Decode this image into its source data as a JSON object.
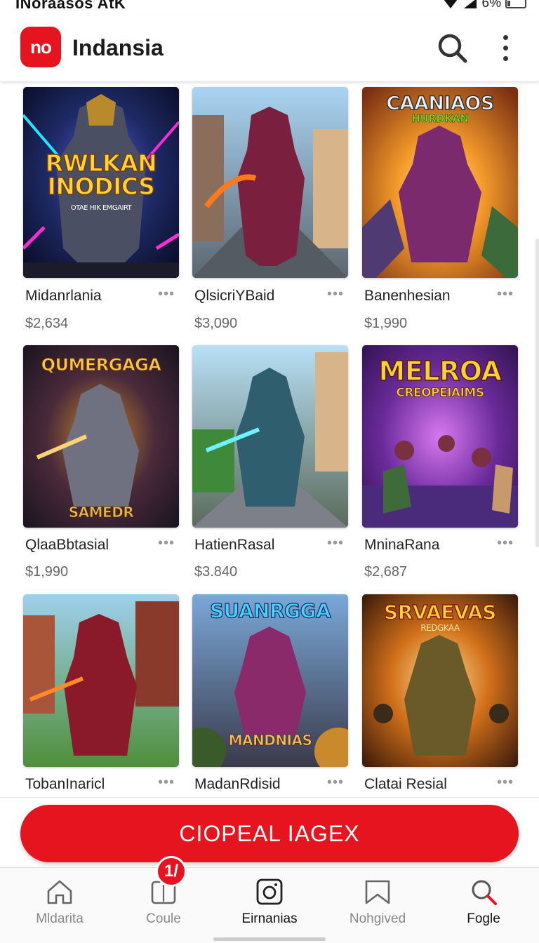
{
  "status_bar": {
    "carrier": "INoraasos AtK",
    "battery": "6%"
  },
  "app_bar": {
    "logo_text": "no",
    "title": "Indansia"
  },
  "grid": {
    "more_glyph": "•••",
    "items": [
      {
        "name": "Midanrlania",
        "price": "$2,634",
        "art_title": "RWLKAN INODICS",
        "art_subtitle": "OTAE HIK EMGAIRT"
      },
      {
        "name": "QlsicriYBaid",
        "price": "$3,090"
      },
      {
        "name": "Banenhesian",
        "price": "$1,990",
        "art_title": "CAANIAOS",
        "art_subtitle": "HURDKAN"
      },
      {
        "name": "QlaaBbtasial",
        "price": "$1,990",
        "art_title": "QUMERGAGA",
        "art_subtitle": "SAMEDR"
      },
      {
        "name": "HatienRasal",
        "price": "$3.840"
      },
      {
        "name": "MninaRana",
        "price": "$2,687",
        "art_title": "MELROA",
        "art_subtitle": "CREOPEIAIMS"
      },
      {
        "name": "TobanInaricl",
        "price": ""
      },
      {
        "name": "MadanRdisid",
        "price": "",
        "art_title": "SUANRGGA",
        "art_subtitle": "MANDNIAS"
      },
      {
        "name": "Clatai Resial",
        "price": "",
        "art_title": "SRVAEVAS",
        "art_subtitle": "REDGKAA"
      }
    ]
  },
  "cta": {
    "label": "CIOPEAL IAGEX"
  },
  "bottom_nav": {
    "badge": "1/",
    "items": [
      {
        "label": "Mldarita",
        "icon": "home-icon"
      },
      {
        "label": "Coule",
        "icon": "phone-icon"
      },
      {
        "label": "Eirnanias",
        "icon": "camera-icon"
      },
      {
        "label": "Nohgived",
        "icon": "bookmark-icon"
      },
      {
        "label": "Fogle",
        "icon": "search-icon"
      }
    ]
  },
  "colors": {
    "accent": "#e5141f"
  }
}
